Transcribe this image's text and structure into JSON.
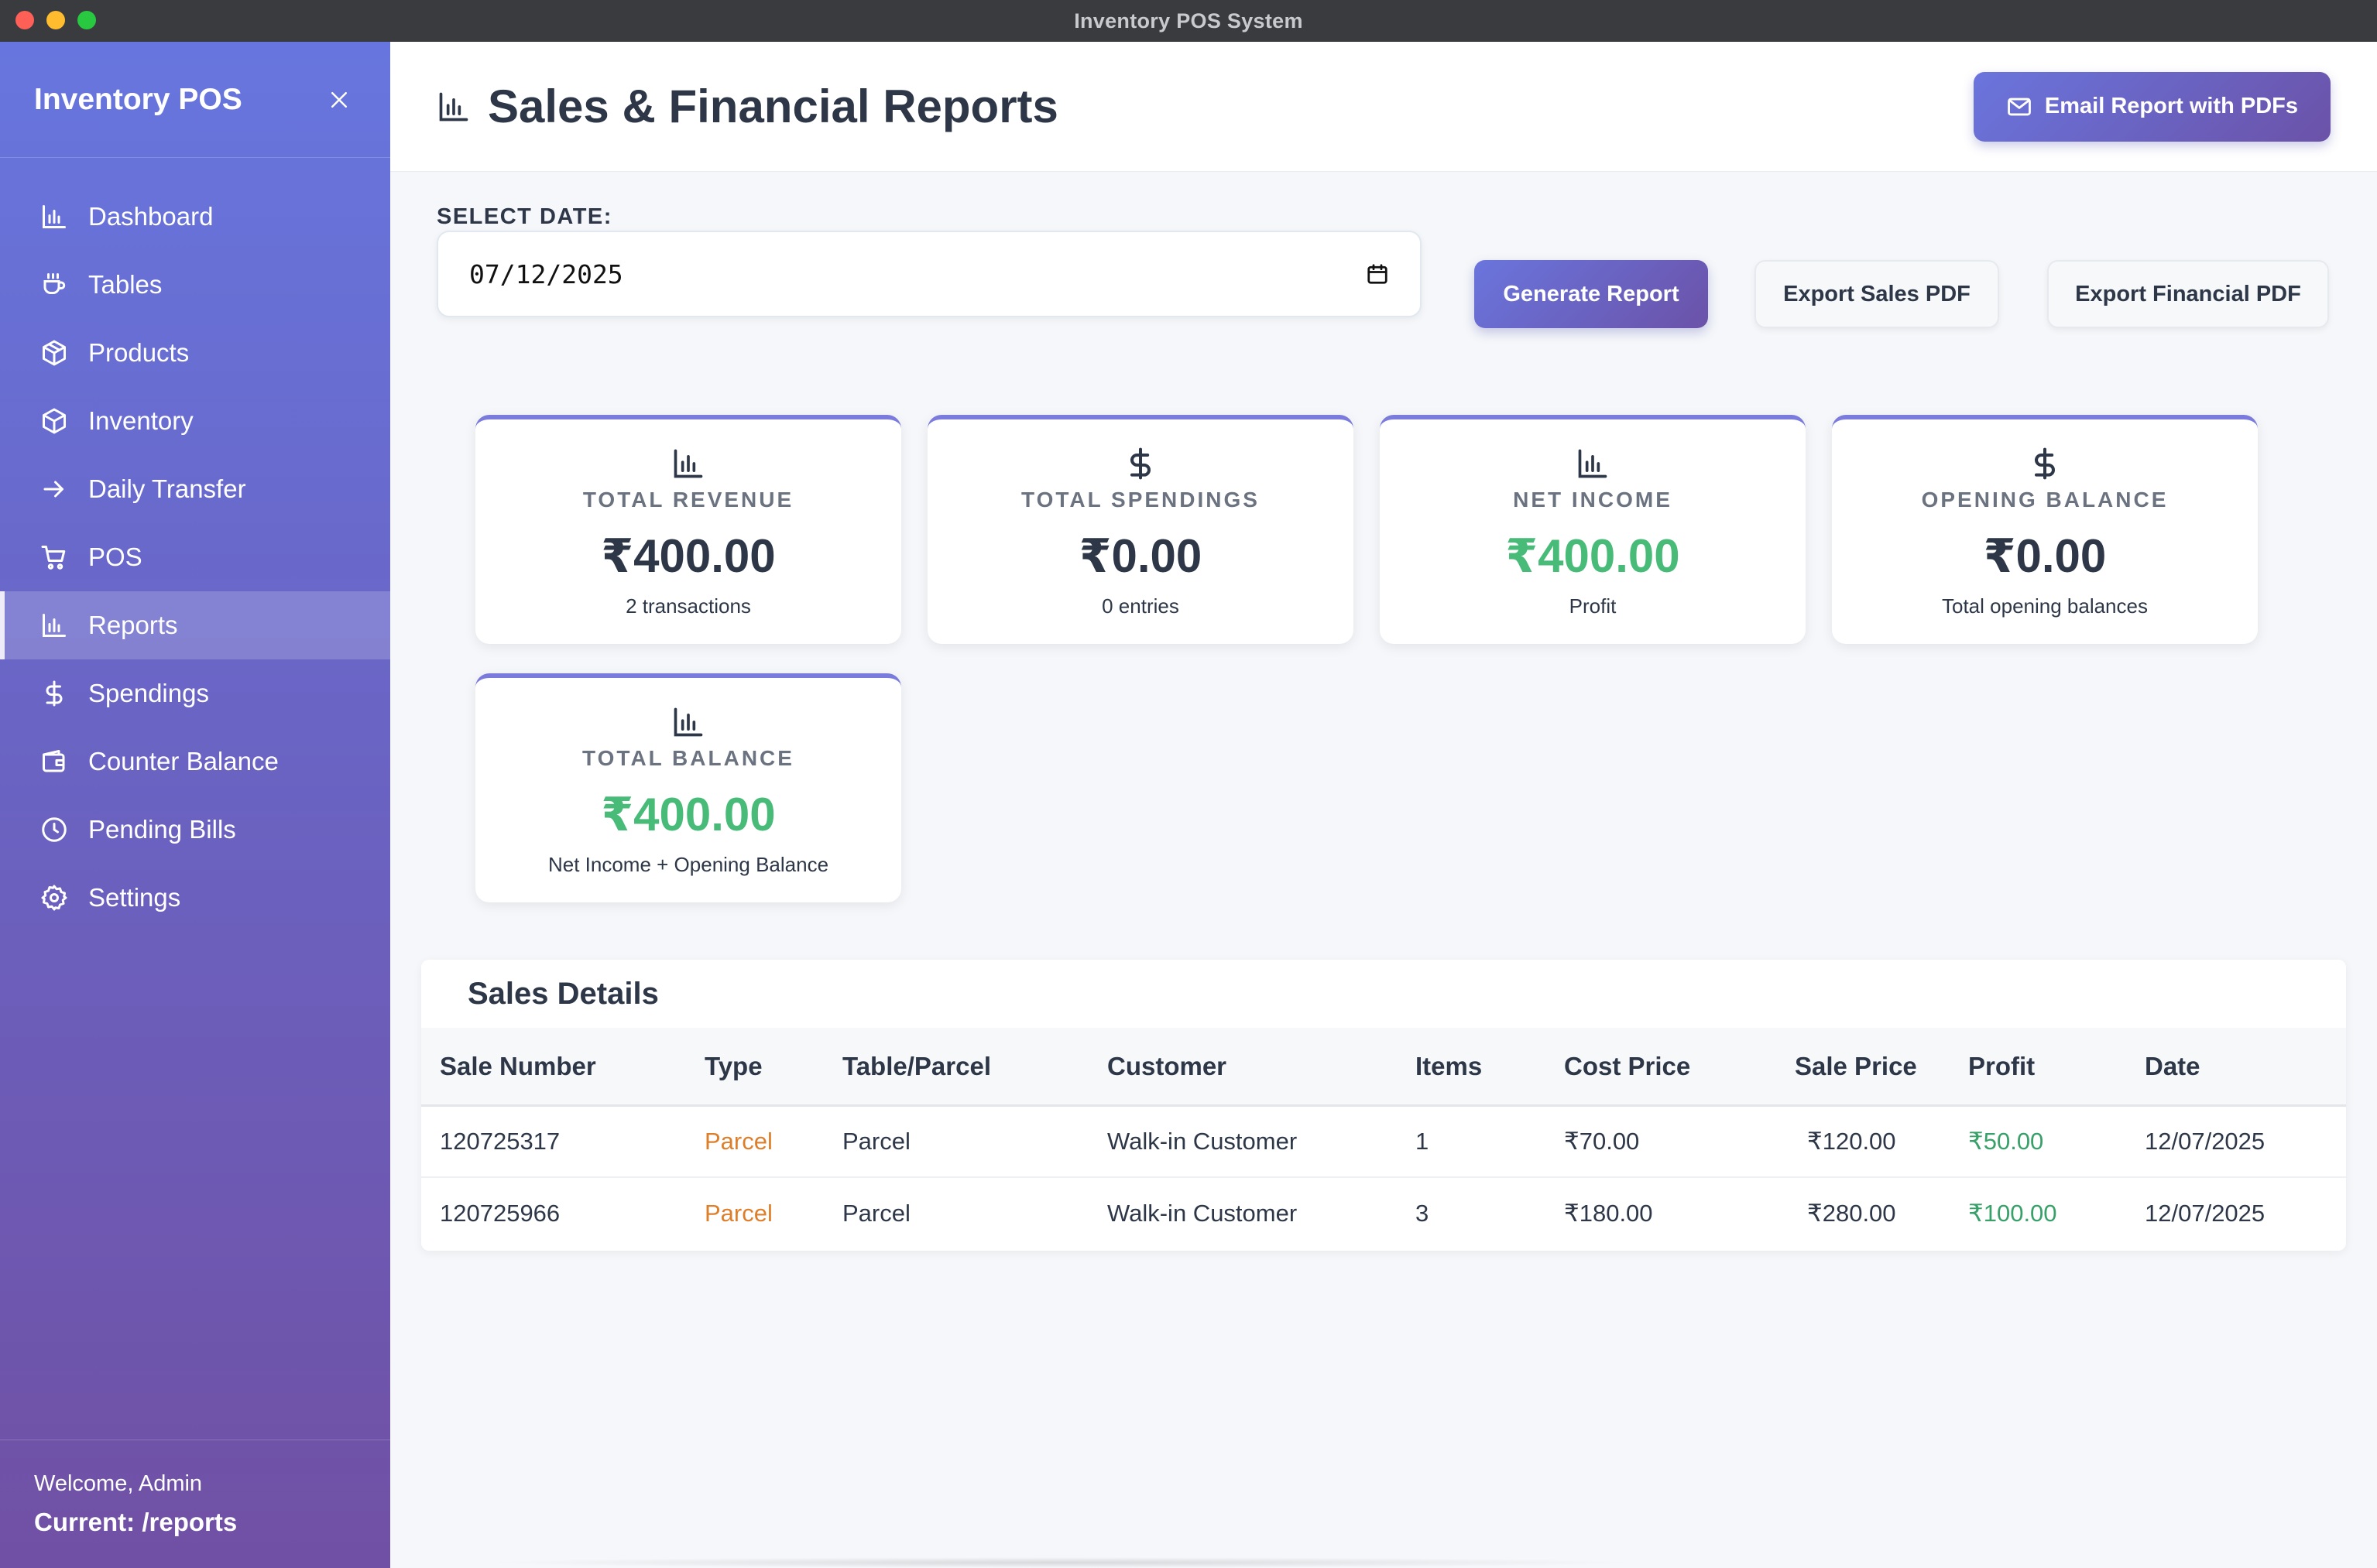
{
  "window": {
    "title": "Inventory POS System"
  },
  "sidebar": {
    "brand": "Inventory POS",
    "items": [
      {
        "label": "Dashboard",
        "icon": "bar-chart-icon"
      },
      {
        "label": "Tables",
        "icon": "coffee-icon"
      },
      {
        "label": "Products",
        "icon": "package-icon"
      },
      {
        "label": "Inventory",
        "icon": "package-icon"
      },
      {
        "label": "Daily Transfer",
        "icon": "arrow-right-icon"
      },
      {
        "label": "POS",
        "icon": "cart-icon"
      },
      {
        "label": "Reports",
        "icon": "bar-chart-icon",
        "active": true
      },
      {
        "label": "Spendings",
        "icon": "dollar-icon"
      },
      {
        "label": "Counter Balance",
        "icon": "wallet-icon"
      },
      {
        "label": "Pending Bills",
        "icon": "clock-icon"
      },
      {
        "label": "Settings",
        "icon": "gear-icon"
      }
    ],
    "welcome": "Welcome, Admin",
    "current": "Current: /reports"
  },
  "header": {
    "title": "Sales & Financial Reports",
    "email_button": "Email Report with PDFs"
  },
  "controls": {
    "date_label": "SELECT DATE:",
    "date_value": "07/12/2025",
    "generate_button": "Generate Report",
    "export_sales_button": "Export Sales PDF",
    "export_financial_button": "Export Financial PDF"
  },
  "stats": {
    "revenue": {
      "title": "TOTAL REVENUE",
      "value": "₹400.00",
      "sub": "2 transactions",
      "icon": "bar-chart-icon"
    },
    "spendings": {
      "title": "TOTAL SPENDINGS",
      "value": "₹0.00",
      "sub": "0 entries",
      "icon": "dollar-icon"
    },
    "net_income": {
      "title": "NET INCOME",
      "value": "₹400.00",
      "sub": "Profit",
      "icon": "bar-chart-icon"
    },
    "opening": {
      "title": "OPENING BALANCE",
      "value": "₹0.00",
      "sub": "Total opening balances",
      "icon": "dollar-icon"
    },
    "balance": {
      "title": "TOTAL BALANCE",
      "value": "₹400.00",
      "sub": "Net Income + Opening Balance",
      "icon": "bar-chart-icon"
    }
  },
  "sales": {
    "title": "Sales Details",
    "columns": [
      "Sale Number",
      "Type",
      "Table/Parcel",
      "Customer",
      "Items",
      "Cost Price",
      "Sale Price",
      "Profit",
      "Date"
    ],
    "rows": [
      [
        "120725317",
        "Parcel",
        "Parcel",
        "Walk-in Customer",
        "1",
        "₹70.00",
        "₹120.00",
        "₹50.00",
        "12/07/2025"
      ],
      [
        "120725966",
        "Parcel",
        "Parcel",
        "Walk-in Customer",
        "3",
        "₹180.00",
        "₹280.00",
        "₹100.00",
        "12/07/2025"
      ]
    ]
  },
  "colors": {
    "accent": "#6a75dd",
    "positive": "#48bb78",
    "type_parcel": "#dd7f2a"
  }
}
